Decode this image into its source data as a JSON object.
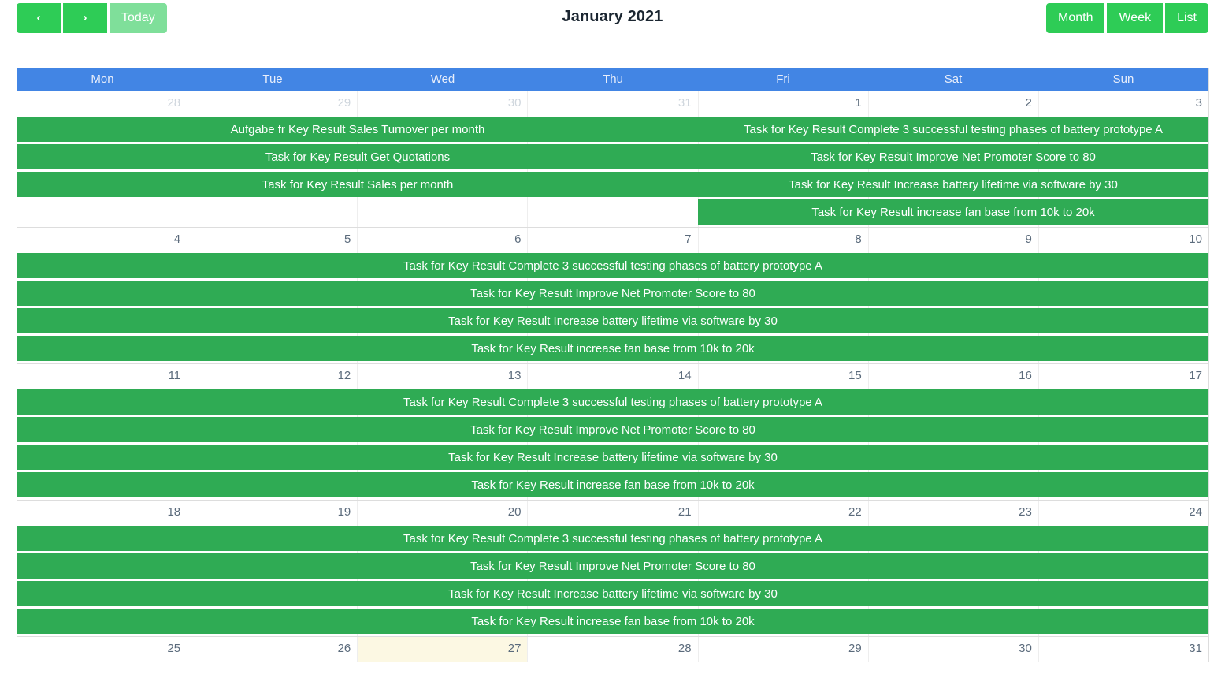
{
  "toolbar": {
    "prev_label": "‹",
    "next_label": "›",
    "today_label": "Today",
    "month_label": "Month",
    "week_label": "Week",
    "list_label": "List"
  },
  "title": "January 2021",
  "colors": {
    "accent_green": "#2fab54",
    "button_green": "#2ecc56",
    "button_green_muted": "#7fdf9a",
    "header_blue": "#4285e4",
    "today_highlight": "#fcf8e3"
  },
  "weekdays": [
    "Mon",
    "Tue",
    "Wed",
    "Thu",
    "Fri",
    "Sat",
    "Sun"
  ],
  "weeks": [
    {
      "days": [
        {
          "num": "28",
          "other_month": true,
          "today": false
        },
        {
          "num": "29",
          "other_month": true,
          "today": false
        },
        {
          "num": "30",
          "other_month": true,
          "today": false
        },
        {
          "num": "31",
          "other_month": true,
          "today": false
        },
        {
          "num": "1",
          "other_month": false,
          "today": false
        },
        {
          "num": "2",
          "other_month": false,
          "today": false
        },
        {
          "num": "3",
          "other_month": false,
          "today": false
        }
      ],
      "rows": [
        [
          {
            "start": 0,
            "span": 4,
            "label": "Aufgabe fr Key Result Sales Turnover per month"
          },
          {
            "start": 4,
            "span": 3,
            "label": "Task for Key Result Complete 3 successful testing phases of battery prototype A"
          }
        ],
        [
          {
            "start": 0,
            "span": 4,
            "label": "Task for Key Result Get Quotations"
          },
          {
            "start": 4,
            "span": 3,
            "label": "Task for Key Result Improve Net Promoter Score to 80"
          }
        ],
        [
          {
            "start": 0,
            "span": 4,
            "label": "Task for Key Result Sales per month"
          },
          {
            "start": 4,
            "span": 3,
            "label": "Task for Key Result Increase battery lifetime via software by 30"
          }
        ],
        [
          {
            "start": 4,
            "span": 3,
            "label": "Task for Key Result increase fan base from 10k to 20k"
          }
        ]
      ]
    },
    {
      "days": [
        {
          "num": "4",
          "other_month": false,
          "today": false
        },
        {
          "num": "5",
          "other_month": false,
          "today": false
        },
        {
          "num": "6",
          "other_month": false,
          "today": false
        },
        {
          "num": "7",
          "other_month": false,
          "today": false
        },
        {
          "num": "8",
          "other_month": false,
          "today": false
        },
        {
          "num": "9",
          "other_month": false,
          "today": false
        },
        {
          "num": "10",
          "other_month": false,
          "today": false
        }
      ],
      "rows": [
        [
          {
            "start": 0,
            "span": 7,
            "label": "Task for Key Result Complete 3 successful testing phases of battery prototype A"
          }
        ],
        [
          {
            "start": 0,
            "span": 7,
            "label": "Task for Key Result Improve Net Promoter Score to 80"
          }
        ],
        [
          {
            "start": 0,
            "span": 7,
            "label": "Task for Key Result Increase battery lifetime via software by 30"
          }
        ],
        [
          {
            "start": 0,
            "span": 7,
            "label": "Task for Key Result increase fan base from 10k to 20k"
          }
        ]
      ]
    },
    {
      "days": [
        {
          "num": "11",
          "other_month": false,
          "today": false
        },
        {
          "num": "12",
          "other_month": false,
          "today": false
        },
        {
          "num": "13",
          "other_month": false,
          "today": false
        },
        {
          "num": "14",
          "other_month": false,
          "today": false
        },
        {
          "num": "15",
          "other_month": false,
          "today": false
        },
        {
          "num": "16",
          "other_month": false,
          "today": false
        },
        {
          "num": "17",
          "other_month": false,
          "today": false
        }
      ],
      "rows": [
        [
          {
            "start": 0,
            "span": 7,
            "label": "Task for Key Result Complete 3 successful testing phases of battery prototype A"
          }
        ],
        [
          {
            "start": 0,
            "span": 7,
            "label": "Task for Key Result Improve Net Promoter Score to 80"
          }
        ],
        [
          {
            "start": 0,
            "span": 7,
            "label": "Task for Key Result Increase battery lifetime via software by 30"
          }
        ],
        [
          {
            "start": 0,
            "span": 7,
            "label": "Task for Key Result increase fan base from 10k to 20k"
          }
        ]
      ]
    },
    {
      "days": [
        {
          "num": "18",
          "other_month": false,
          "today": false
        },
        {
          "num": "19",
          "other_month": false,
          "today": false
        },
        {
          "num": "20",
          "other_month": false,
          "today": false
        },
        {
          "num": "21",
          "other_month": false,
          "today": false
        },
        {
          "num": "22",
          "other_month": false,
          "today": false
        },
        {
          "num": "23",
          "other_month": false,
          "today": false
        },
        {
          "num": "24",
          "other_month": false,
          "today": false
        }
      ],
      "rows": [
        [
          {
            "start": 0,
            "span": 7,
            "label": "Task for Key Result Complete 3 successful testing phases of battery prototype A"
          }
        ],
        [
          {
            "start": 0,
            "span": 7,
            "label": "Task for Key Result Improve Net Promoter Score to 80"
          }
        ],
        [
          {
            "start": 0,
            "span": 7,
            "label": "Task for Key Result Increase battery lifetime via software by 30"
          }
        ],
        [
          {
            "start": 0,
            "span": 7,
            "label": "Task for Key Result increase fan base from 10k to 20k"
          }
        ]
      ]
    },
    {
      "days": [
        {
          "num": "25",
          "other_month": false,
          "today": false
        },
        {
          "num": "26",
          "other_month": false,
          "today": false
        },
        {
          "num": "27",
          "other_month": false,
          "today": true
        },
        {
          "num": "28",
          "other_month": false,
          "today": false
        },
        {
          "num": "29",
          "other_month": false,
          "today": false
        },
        {
          "num": "30",
          "other_month": false,
          "today": false
        },
        {
          "num": "31",
          "other_month": false,
          "today": false
        }
      ],
      "rows": []
    }
  ]
}
